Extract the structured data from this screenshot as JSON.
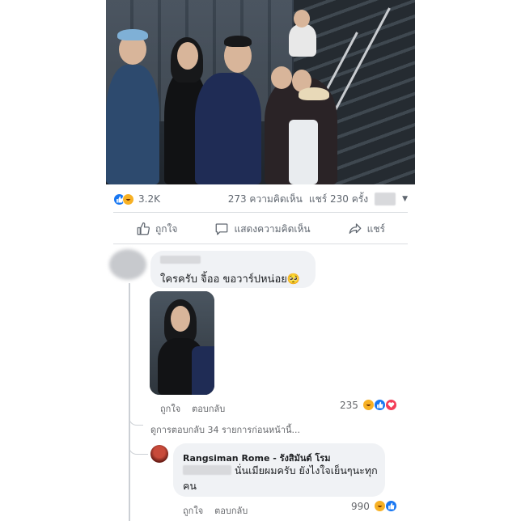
{
  "post": {
    "reaction_count": "3.2K",
    "comments_count": "273 ความคิดเห็น",
    "shares_count": "แชร์ 230 ครั้ง"
  },
  "actions": {
    "like": "ถูกใจ",
    "comment": "แสดงความคิดเห็น",
    "share": "แชร์"
  },
  "comment1": {
    "text": "ใครครับ จิ้ออ ขอวาร์ปหน่อย🥺",
    "like_label": "ถูกใจ",
    "reply_label": "ตอบกลับ",
    "reaction_count": "235"
  },
  "replies_link": "ดูการตอบกลับ 34 รายการก่อนหน้านี้...",
  "reply": {
    "author": "Rangsiman Rome - รังสิมันต์ โรม",
    "text_line1": "นั่นเมียผมครับ ยังไงใจเย็นๆนะทุก",
    "text_line2": "คน",
    "like_label": "ถูกใจ",
    "reply_label": "ตอบกลับ",
    "reaction_count": "990"
  },
  "colors": {
    "like_blue": "#1877f2",
    "haha_yellow": "#f7b125",
    "love_red": "#f33e58",
    "bubble_gray": "#f0f2f5"
  }
}
